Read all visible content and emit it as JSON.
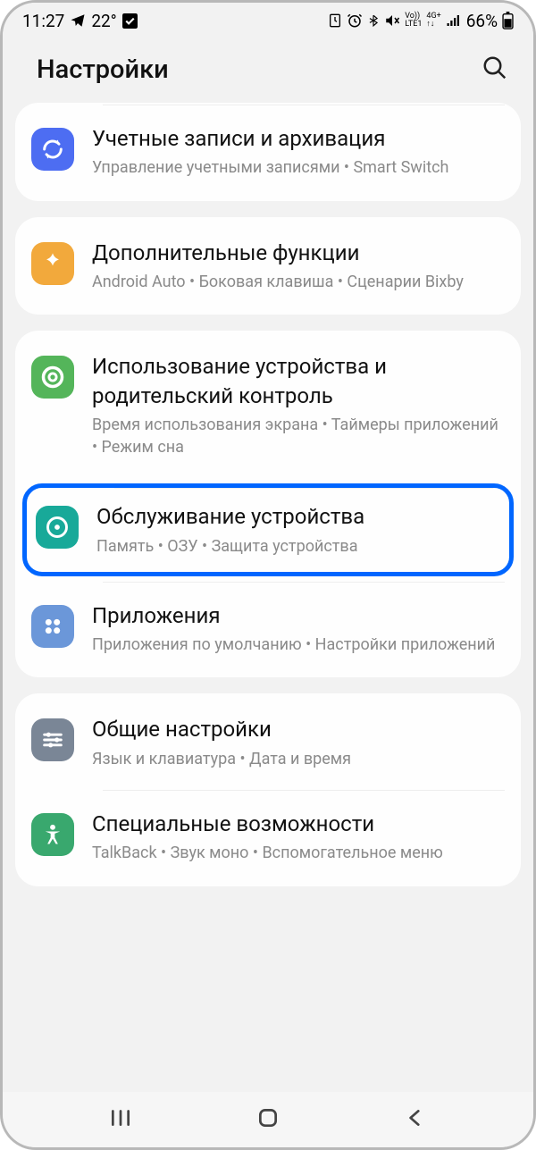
{
  "status": {
    "time": "11:27",
    "temp": "22°",
    "battery": "66%",
    "net1": "Vo))",
    "net2": "LTE1",
    "net3": "4G+"
  },
  "header": {
    "title": "Настройки"
  },
  "groups": [
    {
      "dividerTop": true,
      "items": [
        {
          "key": "accounts",
          "icon": "sync-icon",
          "color": "ic-blue",
          "title": "Учетные записи и архивация",
          "sub": "Управление учетными записями • Smart Switch"
        }
      ]
    },
    {
      "items": [
        {
          "key": "advanced",
          "icon": "plus-icon",
          "color": "ic-orange",
          "title": "Дополнительные функции",
          "sub": "Android Auto • Боковая клавиша • Сценарии Bixby"
        }
      ]
    },
    {
      "items": [
        {
          "key": "wellbeing",
          "icon": "target-icon",
          "color": "ic-green1",
          "title": "Использование устройства и родительский контроль",
          "sub": "Время использования экрана • Таймеры приложений • Режим сна"
        },
        {
          "key": "maintenance",
          "icon": "gauge-icon",
          "color": "ic-teal",
          "title": "Обслуживание устройства",
          "sub": "Память • ОЗУ • Защита устройства",
          "highlight": true
        },
        {
          "key": "apps",
          "icon": "grid-icon",
          "color": "ic-lblue",
          "title": "Приложения",
          "sub": "Приложения по умолчанию • Настройки приложений"
        }
      ]
    },
    {
      "items": [
        {
          "key": "general",
          "icon": "sliders-icon",
          "color": "ic-grey",
          "title": "Общие настройки",
          "sub": "Язык и клавиатура • Дата и время"
        },
        {
          "key": "accessibility",
          "icon": "person-icon",
          "color": "ic-green2",
          "title": "Специальные возможности",
          "sub": "TalkBack • Звук моно • Вспомогательное меню"
        }
      ]
    }
  ]
}
